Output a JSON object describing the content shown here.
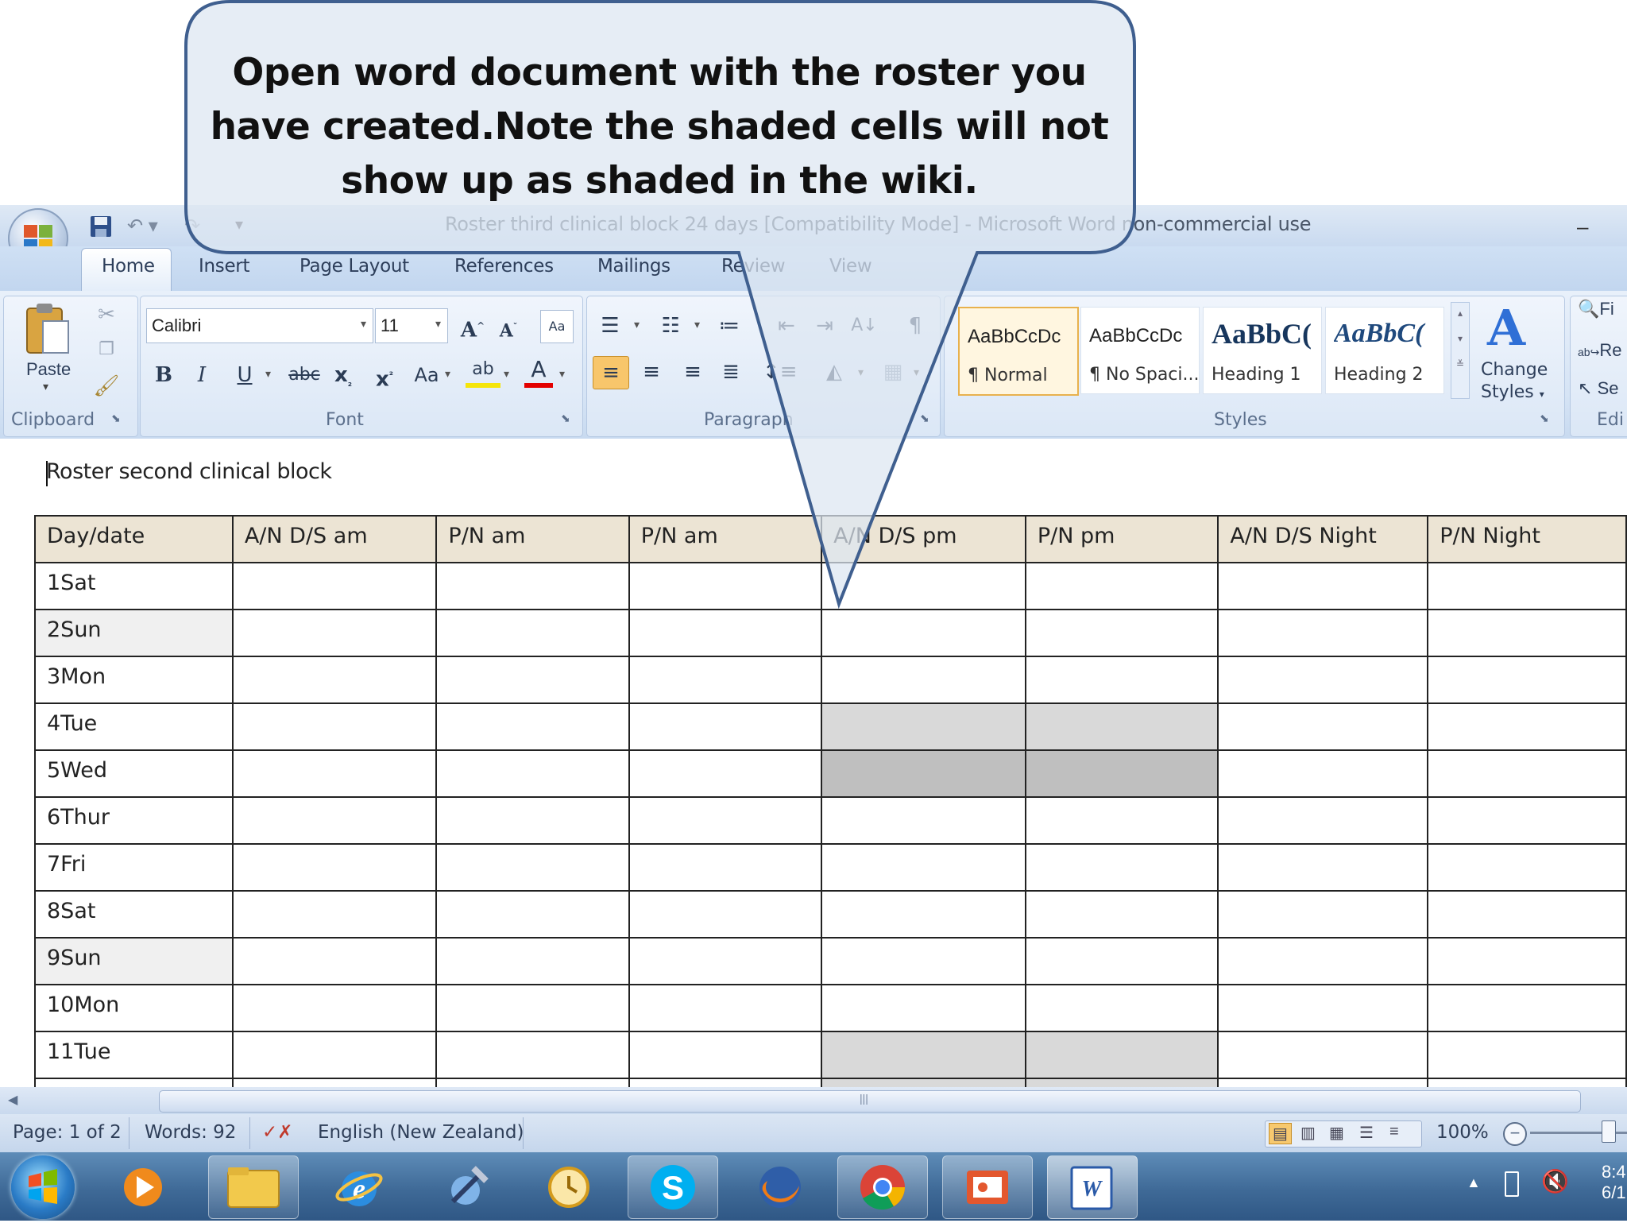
{
  "window": {
    "title": "Roster third clinical block 24 days [Compatibility Mode] - Microsoft Word non-commercial use"
  },
  "tabs": [
    {
      "label": "Home"
    },
    {
      "label": "Insert"
    },
    {
      "label": "Page Layout"
    },
    {
      "label": "References"
    },
    {
      "label": "Mailings"
    },
    {
      "label": "Review"
    },
    {
      "label": "View"
    }
  ],
  "ribbon": {
    "clipboard": {
      "group_label": "Clipboard",
      "paste_label": "Paste"
    },
    "font": {
      "group_label": "Font",
      "font_name": "Calibri",
      "font_size": "11"
    },
    "paragraph": {
      "group_label": "Paragraph"
    },
    "styles": {
      "group_label": "Styles",
      "items": [
        {
          "sample": "AaBbCcDc",
          "name": "¶ Normal"
        },
        {
          "sample": "AaBbCcDc",
          "name": "¶ No Spaci..."
        },
        {
          "sample": "AaBbC(",
          "name": "Heading 1"
        },
        {
          "sample": "AaBbC(",
          "name": "Heading 2"
        }
      ],
      "change_styles_line1": "Change",
      "change_styles_line2": "Styles"
    },
    "editing": {
      "group_label": "Edi",
      "find": "Fi",
      "replace": "Re",
      "select": "Se"
    }
  },
  "document": {
    "heading": "Roster second clinical block",
    "table": {
      "headers": [
        "Day/date",
        "A/N  D/S am",
        "P/N am",
        "P/N am",
        "A/N D/S pm",
        "P/N pm",
        "A/N  D/S Night",
        "P/N Night"
      ],
      "rows": [
        "1Sat",
        "2Sun",
        "3Mon",
        "4Tue",
        "5Wed",
        "6Thur",
        "7Fri",
        "8Sat",
        "9Sun",
        "10Mon",
        "11Tue"
      ]
    }
  },
  "statusbar": {
    "page": "Page: 1 of 2",
    "words": "Words: 92",
    "language": "English (New Zealand)",
    "zoom": "100%"
  },
  "taskbar": {
    "clock_time": "8:4",
    "clock_date": "6/1"
  },
  "callout": {
    "text": "Open word document with the roster you have created.Note the shaded cells will not show up as shaded in the wiki."
  },
  "colors": {
    "ribbon": "#d6e4f5",
    "header_fill": "#ece4d4",
    "shade_light": "#d9d9d9",
    "shade_dark": "#bfbfbf",
    "callout_fill": "#dde6f1",
    "callout_border": "#3f5f8f"
  }
}
